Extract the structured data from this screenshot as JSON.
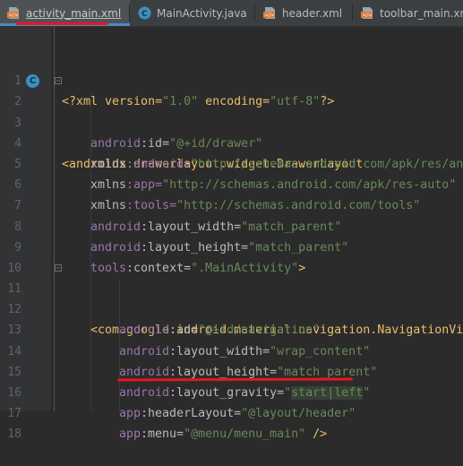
{
  "tabs": [
    {
      "label": "activity_main.xml",
      "icon": "xml-file-icon",
      "active": true
    },
    {
      "label": "MainActivity.java",
      "icon": "java-class-icon",
      "active": false
    },
    {
      "label": "header.xml",
      "icon": "xml-file-icon",
      "active": false
    },
    {
      "label": "toolbar_main.xml",
      "icon": "xml-file-icon",
      "active": false
    }
  ],
  "gutter_marker": "C",
  "line_numbers": [
    "1",
    "2",
    "3",
    "4",
    "5",
    "6",
    "7",
    "8",
    "9",
    "10",
    "11",
    "12",
    "13",
    "14",
    "15",
    "16",
    "17",
    "18"
  ],
  "code": {
    "l1": {
      "p1": "<?xml version=",
      "p2": "\"1.0\"",
      "p3": " encoding=",
      "p4": "\"utf-8\"",
      "p5": "?>"
    },
    "l2": {
      "p1": "<androidx.drawerlayout.widget.DrawerLayout"
    },
    "l3": {
      "ns": "android",
      "attr": ":id=",
      "val": "\"@+id/drawer\""
    },
    "l4": {
      "ns": "xmlns",
      "attr": ":android=",
      "val": "\"http://schemas.android.com/apk/res/an"
    },
    "l5": {
      "ns": "xmlns",
      "attr": ":app=",
      "val": "\"http://schemas.android.com/apk/res-auto\""
    },
    "l6": {
      "ns": "xmlns",
      "attr": ":tools=",
      "val": "\"http://schemas.android.com/tools\""
    },
    "l7": {
      "ns": "android",
      "attr": ":layout_width=",
      "val": "\"match_parent\""
    },
    "l8": {
      "ns": "android",
      "attr": ":layout_height=",
      "val": "\"match_parent\""
    },
    "l9": {
      "ns": "tools",
      "attr": ":context=",
      "val": "\".MainActivity\"",
      "end": ">"
    },
    "l11": {
      "p1": "<com.google.android.material.navigation.NavigationVi"
    },
    "l12": {
      "ns": "android",
      "attr": ":id=",
      "val": "\"@+id/navigation\""
    },
    "l13": {
      "ns": "android",
      "attr": ":layout_width=",
      "val": "\"wrap_content\""
    },
    "l14": {
      "ns": "android",
      "attr": ":layout_height=",
      "val": "\"match_parent\""
    },
    "l15": {
      "ns": "android",
      "attr": ":layout_gravity=",
      "q1": "\"",
      "v1": "start",
      "sep": "|",
      "v2": "left",
      "q2": "\""
    },
    "l16": {
      "ns": "app",
      "attr": ":headerLayout=",
      "val": "\"@layout/header\""
    },
    "l17": {
      "ns": "app",
      "attr": ":menu=",
      "val": "\"@menu/menu_main\"",
      "end": " />"
    }
  },
  "annotation_color": "#e8161d"
}
